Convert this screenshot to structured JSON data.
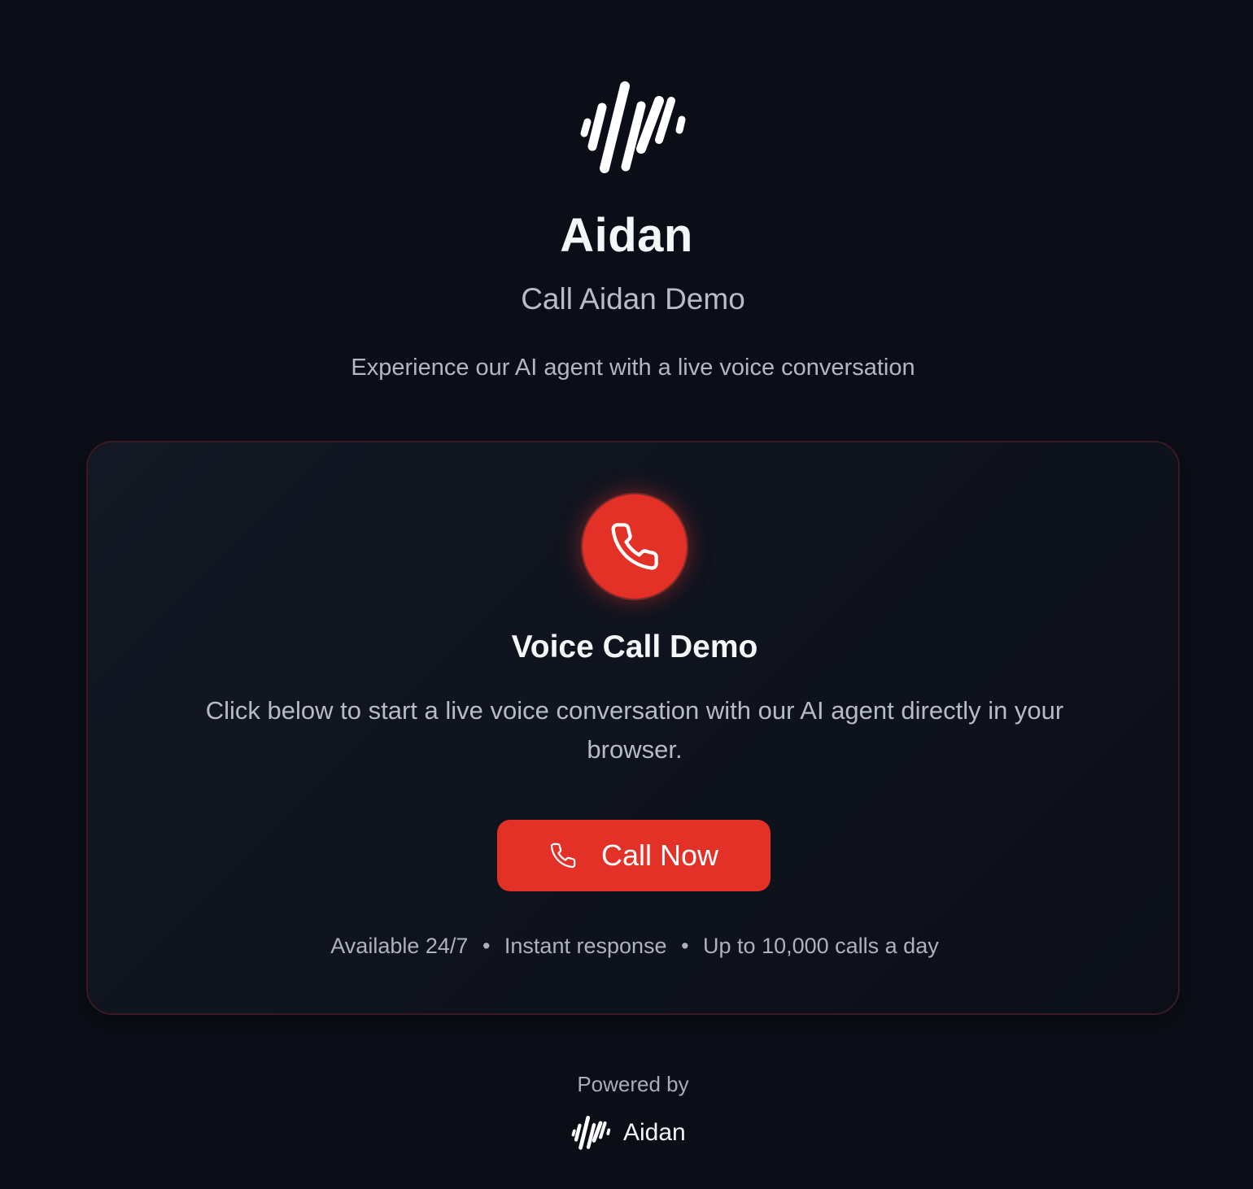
{
  "brand": {
    "name": "Aidan",
    "subtitle": "Call Aidan Demo",
    "tagline": "Experience our AI agent with a live voice conversation",
    "logo_icon": "sound-wave-logo-icon"
  },
  "card": {
    "icon": "phone-icon",
    "title": "Voice Call Demo",
    "description": "Click below to start a live voice conversation with our AI agent directly in your browser.",
    "button_label": "Call Now",
    "button_icon": "phone-icon",
    "features": [
      "Available 24/7",
      "Instant response",
      "Up to 10,000 calls a day"
    ],
    "separator": "•"
  },
  "footer": {
    "powered_by": "Powered by",
    "brand_name": "Aidan"
  },
  "colors": {
    "background": "#0b0e17",
    "accent": "#e33128",
    "card_border": "#3a1a22",
    "text_primary": "#f5f6f8",
    "text_secondary": "#b7bbc6"
  }
}
